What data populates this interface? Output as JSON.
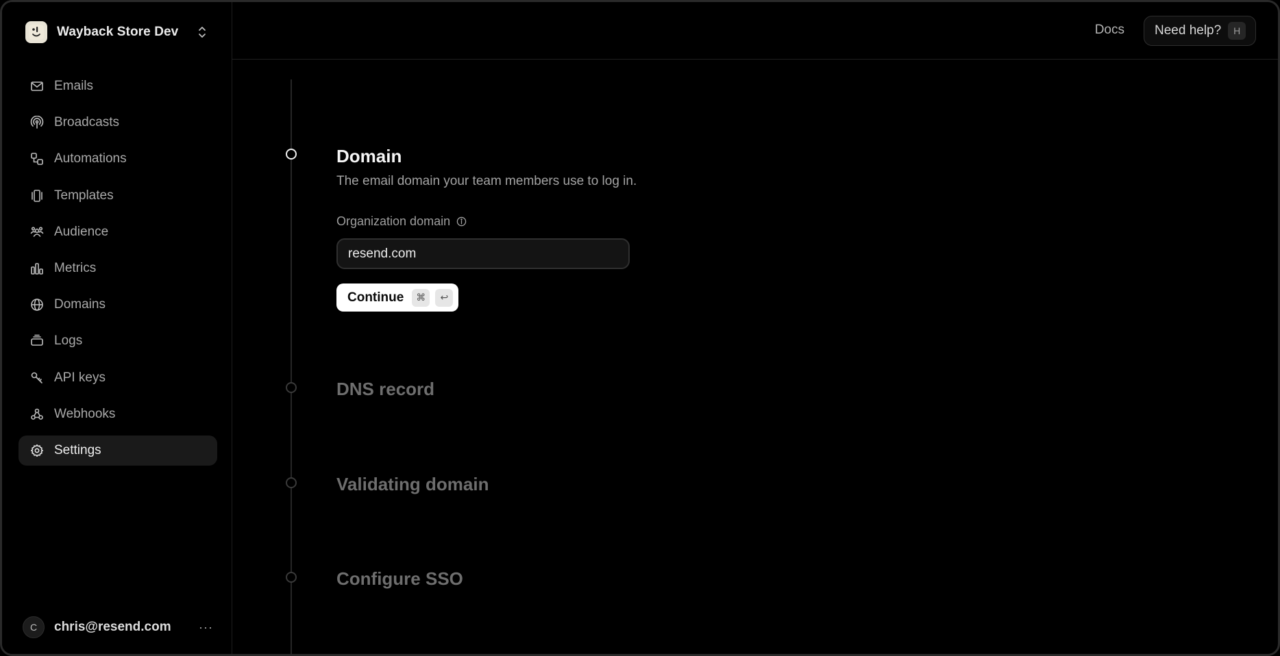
{
  "team": {
    "name": "Wayback Store Dev"
  },
  "sidebar": {
    "items": [
      {
        "label": "Emails",
        "icon": "mail-icon"
      },
      {
        "label": "Broadcasts",
        "icon": "broadcast-icon"
      },
      {
        "label": "Automations",
        "icon": "automation-icon"
      },
      {
        "label": "Templates",
        "icon": "templates-icon"
      },
      {
        "label": "Audience",
        "icon": "audience-icon"
      },
      {
        "label": "Metrics",
        "icon": "metrics-icon"
      },
      {
        "label": "Domains",
        "icon": "globe-icon"
      },
      {
        "label": "Logs",
        "icon": "logs-icon"
      },
      {
        "label": "API keys",
        "icon": "key-icon"
      },
      {
        "label": "Webhooks",
        "icon": "webhook-icon"
      },
      {
        "label": "Settings",
        "icon": "gear-icon",
        "active": true
      }
    ]
  },
  "user": {
    "initial": "C",
    "email": "chris@resend.com",
    "more": "···"
  },
  "topbar": {
    "docs": "Docs",
    "help": "Need help?",
    "help_key": "H"
  },
  "steps": {
    "domain": {
      "title": "Domain",
      "description": "The email domain your team members use to log in.",
      "field_label": "Organization domain",
      "field_value": "resend.com",
      "continue_label": "Continue",
      "shortcut_cmd": "⌘",
      "shortcut_enter": "↩"
    },
    "dns": {
      "title": "DNS record"
    },
    "validating": {
      "title": "Validating domain"
    },
    "sso": {
      "title": "Configure SSO"
    }
  },
  "colors": {
    "background": "#000000",
    "active_nav": "#1a1a1a",
    "button": "#ffffff"
  }
}
